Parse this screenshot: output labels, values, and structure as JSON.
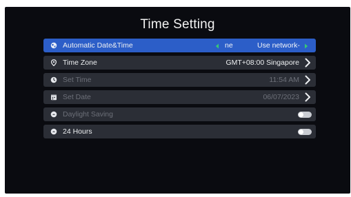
{
  "screen": {
    "title": "Time Setting"
  },
  "settings": {
    "automatic": {
      "label": "Automatic Date&Time",
      "value_partial": "ne",
      "value_option": "Use network-",
      "icon": "globe-icon",
      "selected": true
    },
    "timezone": {
      "label": "Time Zone",
      "value": "GMT+08:00 Singapore",
      "icon": "location-pin-icon"
    },
    "set_time": {
      "label": "Set Time",
      "value": "11:54 AM",
      "icon": "clock-icon",
      "disabled": true
    },
    "set_date": {
      "label": "Set Date",
      "value": "06/07/2023",
      "icon": "calendar-icon",
      "disabled": true
    },
    "daylight": {
      "label": "Daylight Saving",
      "icon": "sun-clock-icon",
      "disabled": true,
      "enabled": false
    },
    "hours24": {
      "label": "24 Hours",
      "icon": "clock-24-icon",
      "enabled": false
    }
  },
  "colors": {
    "background": "#0a0b10",
    "row": "#2b2e36",
    "selected_row": "#2c5ec8",
    "accent_arrow": "#37c777",
    "text": "#eef0f2",
    "disabled_text": "#6d7079",
    "toggle_off": "#c9ccd2"
  }
}
